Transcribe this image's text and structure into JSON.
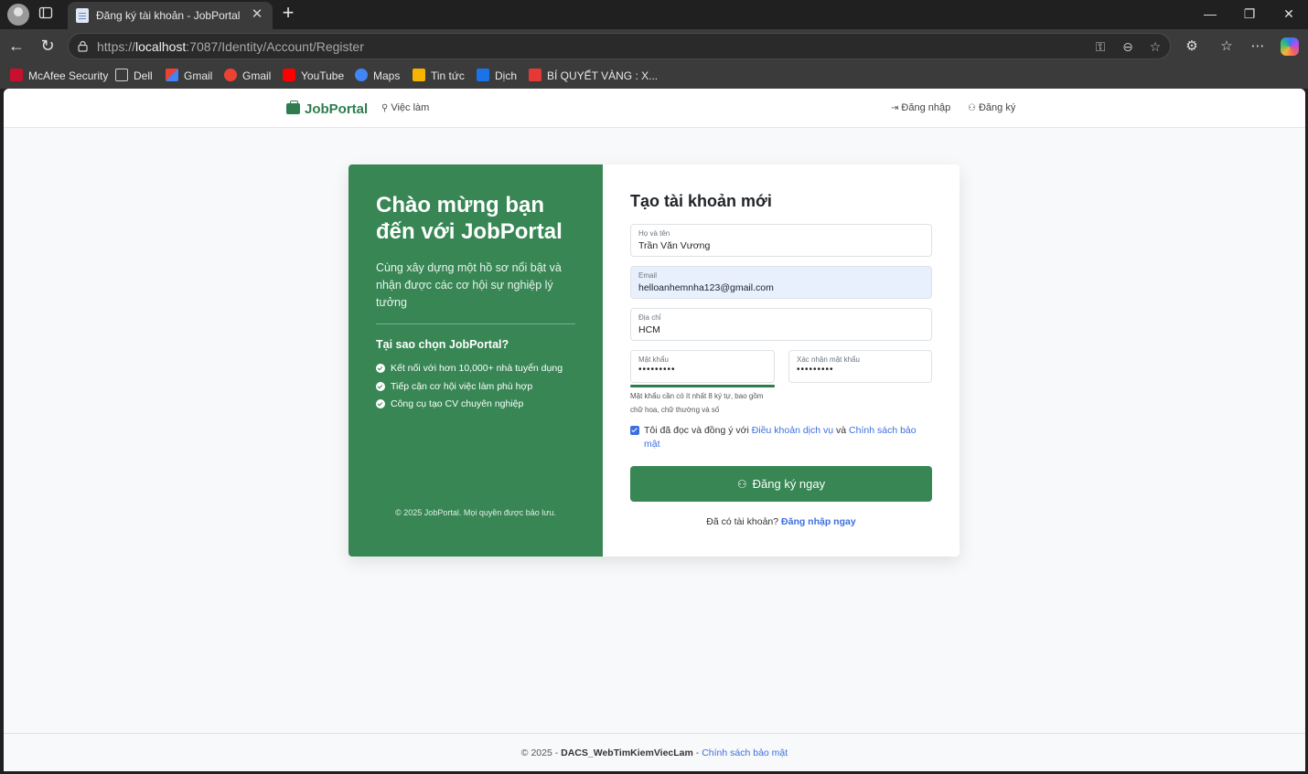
{
  "browser": {
    "tab_title": "Đăng ký tài khoản - JobPortal",
    "url_prefix": "https://",
    "url_host": "localhost",
    "url_path": ":7087/Identity/Account/Register",
    "bookmarks": [
      {
        "label": "McAfee Security",
        "color": "#c8102e"
      },
      {
        "label": "Dell",
        "color": "folder"
      },
      {
        "label": "Gmail",
        "color": "#ea4335"
      },
      {
        "label": "Gmail",
        "color": "#ea4335"
      },
      {
        "label": "YouTube",
        "color": "#ff0000"
      },
      {
        "label": "Maps",
        "color": "#4285f4"
      },
      {
        "label": "Tin tức",
        "color": "#f4b400"
      },
      {
        "label": "Dịch",
        "color": "#1a73e8"
      },
      {
        "label": "BÍ QUYẾT VÀNG : X...",
        "color": "#e53935"
      }
    ]
  },
  "nav": {
    "brand": "JobPortal",
    "jobs_link": "Việc làm",
    "login_link": "Đăng nhập",
    "register_link": "Đăng ký"
  },
  "left_panel": {
    "welcome": "Chào mừng bạn đến với JobPortal",
    "lead": "Cùng xây dựng một hồ sơ nổi bật và nhận được các cơ hội sự nghiệp lý tưởng",
    "why_title": "Tại sao chọn JobPortal?",
    "features": [
      "Kết nối với hơn 10,000+ nhà tuyển dụng",
      "Tiếp cận cơ hội việc làm phù hợp",
      "Công cụ tạo CV chuyên nghiệp"
    ],
    "copyright": "© 2025 JobPortal. Mọi quyền được bảo lưu."
  },
  "form": {
    "title": "Tạo tài khoản mới",
    "fullname": {
      "label": "Họ và tên",
      "value": "Trần Văn Vương"
    },
    "email": {
      "label": "Email",
      "value": "helloanhemnha123@gmail.com"
    },
    "address": {
      "label": "Địa chỉ",
      "value": "HCM"
    },
    "password": {
      "label": "Mật khẩu",
      "value": "•••••••••"
    },
    "confirm_password": {
      "label": "Xác nhận mật khẩu",
      "value": "•••••••••"
    },
    "password_strength": 1.0,
    "password_hint": "Mật khẩu cần có ít nhất 8 ký tự, bao gồm chữ hoa, chữ thường và số",
    "agree_prefix": "Tôi đã đọc và đồng ý với ",
    "terms_link": "Điều khoản dịch vụ",
    "agree_and": " và ",
    "privacy_link": "Chính sách bảo mật",
    "agree_checked": true,
    "submit": "Đăng ký ngay",
    "have_account": "Đã có tài khoản? ",
    "login_now": "Đăng nhập ngay"
  },
  "footer": {
    "prefix": "© 2025 - ",
    "project": "DACS_WebTimKiemViecLam",
    "sep": " - ",
    "privacy": "Chính sách bảo mật"
  },
  "colors": {
    "primary": "#378654",
    "link": "#3d6fe0"
  }
}
